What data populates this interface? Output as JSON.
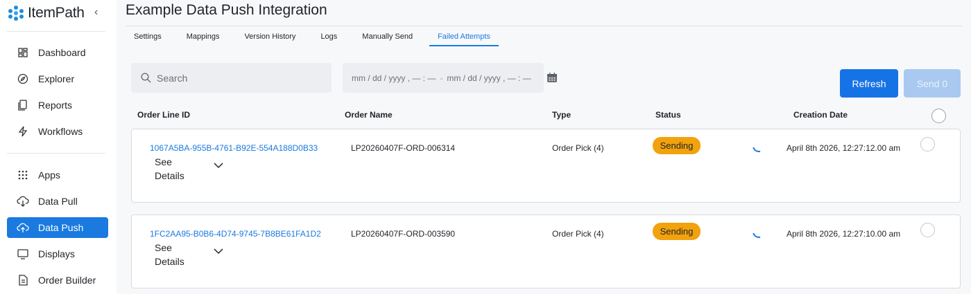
{
  "app": {
    "logo_text": "ItemPath",
    "brand_color": "#1a7ae0"
  },
  "sidebar": {
    "items": [
      {
        "label": "Dashboard",
        "icon": "dashboard-icon"
      },
      {
        "label": "Explorer",
        "icon": "compass-icon"
      },
      {
        "label": "Reports",
        "icon": "reports-icon"
      },
      {
        "label": "Workflows",
        "icon": "lightning-icon"
      },
      {
        "label": "Apps",
        "icon": "apps-grid-icon"
      },
      {
        "label": "Data Pull",
        "icon": "cloud-download-icon"
      },
      {
        "label": "Data Push",
        "icon": "cloud-upload-icon",
        "active": true
      },
      {
        "label": "Displays",
        "icon": "monitor-icon"
      },
      {
        "label": "Order Builder",
        "icon": "document-icon"
      }
    ]
  },
  "page": {
    "title": "Example Data Push Integration"
  },
  "tabs": [
    {
      "label": "Settings"
    },
    {
      "label": "Mappings"
    },
    {
      "label": "Version History"
    },
    {
      "label": "Logs"
    },
    {
      "label": "Manually Send"
    },
    {
      "label": "Failed Attempts",
      "active": true
    }
  ],
  "filters": {
    "search_placeholder": "Search",
    "date_start_placeholder": "mm / dd / yyyy , — : —",
    "date_separator": "-",
    "date_end_placeholder": "mm / dd / yyyy , — : —"
  },
  "actions": {
    "refresh_label": "Refresh",
    "send_label": "Send 0"
  },
  "table": {
    "columns": [
      "Order Line ID",
      "Order Name",
      "Type",
      "Status",
      "Creation Date"
    ],
    "see_details_label": "See Details",
    "rows": [
      {
        "order_line_id": "1067A5BA-955B-4761-B92E-554A188D0B33",
        "order_name": "LP20260407F-ORD-006314",
        "type": "Order Pick (4)",
        "status": "Sending",
        "creation_date": "April 8th 2026, 12:27:12.00 am"
      },
      {
        "order_line_id": "1FC2AA95-B0B6-4D74-9745-7B8BE61FA1D2",
        "order_name": "LP20260407F-ORD-003590",
        "type": "Order Pick (4)",
        "status": "Sending",
        "creation_date": "April 8th 2026, 12:27:10.00 am"
      }
    ]
  },
  "colors": {
    "status_sending": "#f2a20d",
    "primary_button": "#1673e6",
    "disabled_button": "#a9c9f1"
  }
}
